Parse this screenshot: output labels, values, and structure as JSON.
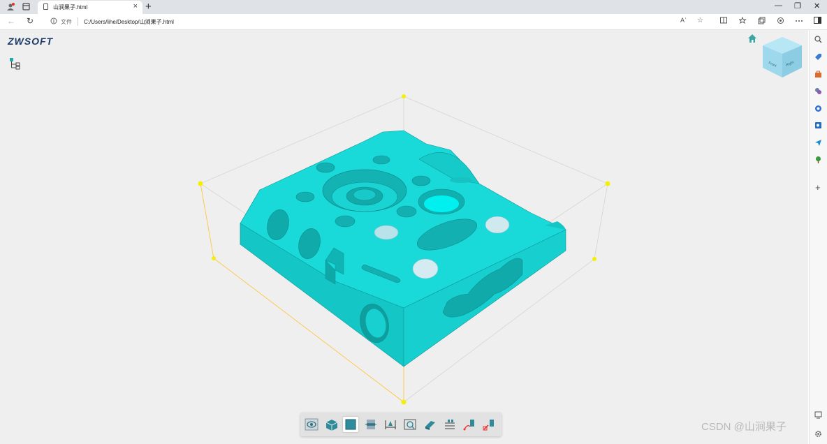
{
  "browser": {
    "tab_title": "山涧果子.html",
    "tab_close": "×",
    "new_tab": "+",
    "minimize": "—",
    "restore": "❐",
    "close": "✕",
    "back": "←",
    "refresh": "↻",
    "url_label": "文件",
    "url": "C:/Users/lihe/Desktop/山涧果子.html",
    "reader_icon": "Aʾ",
    "fav_icon": "☆"
  },
  "app": {
    "logo_text": "ZWSOFT",
    "model_color": "#19d9d9",
    "bbox_color": "#ffd21a"
  },
  "viewcube": {
    "face_label_left": "Front",
    "face_label_right": "Right"
  },
  "toolbar": {
    "tools": [
      "view-icon",
      "shaded-icon",
      "shaded-edges-icon",
      "section-icon",
      "measure-icon",
      "fit-icon",
      "explode-icon",
      "properties-icon",
      "markup-icon",
      "settings-icon"
    ]
  },
  "watermark": "CSDN @山涧果子"
}
